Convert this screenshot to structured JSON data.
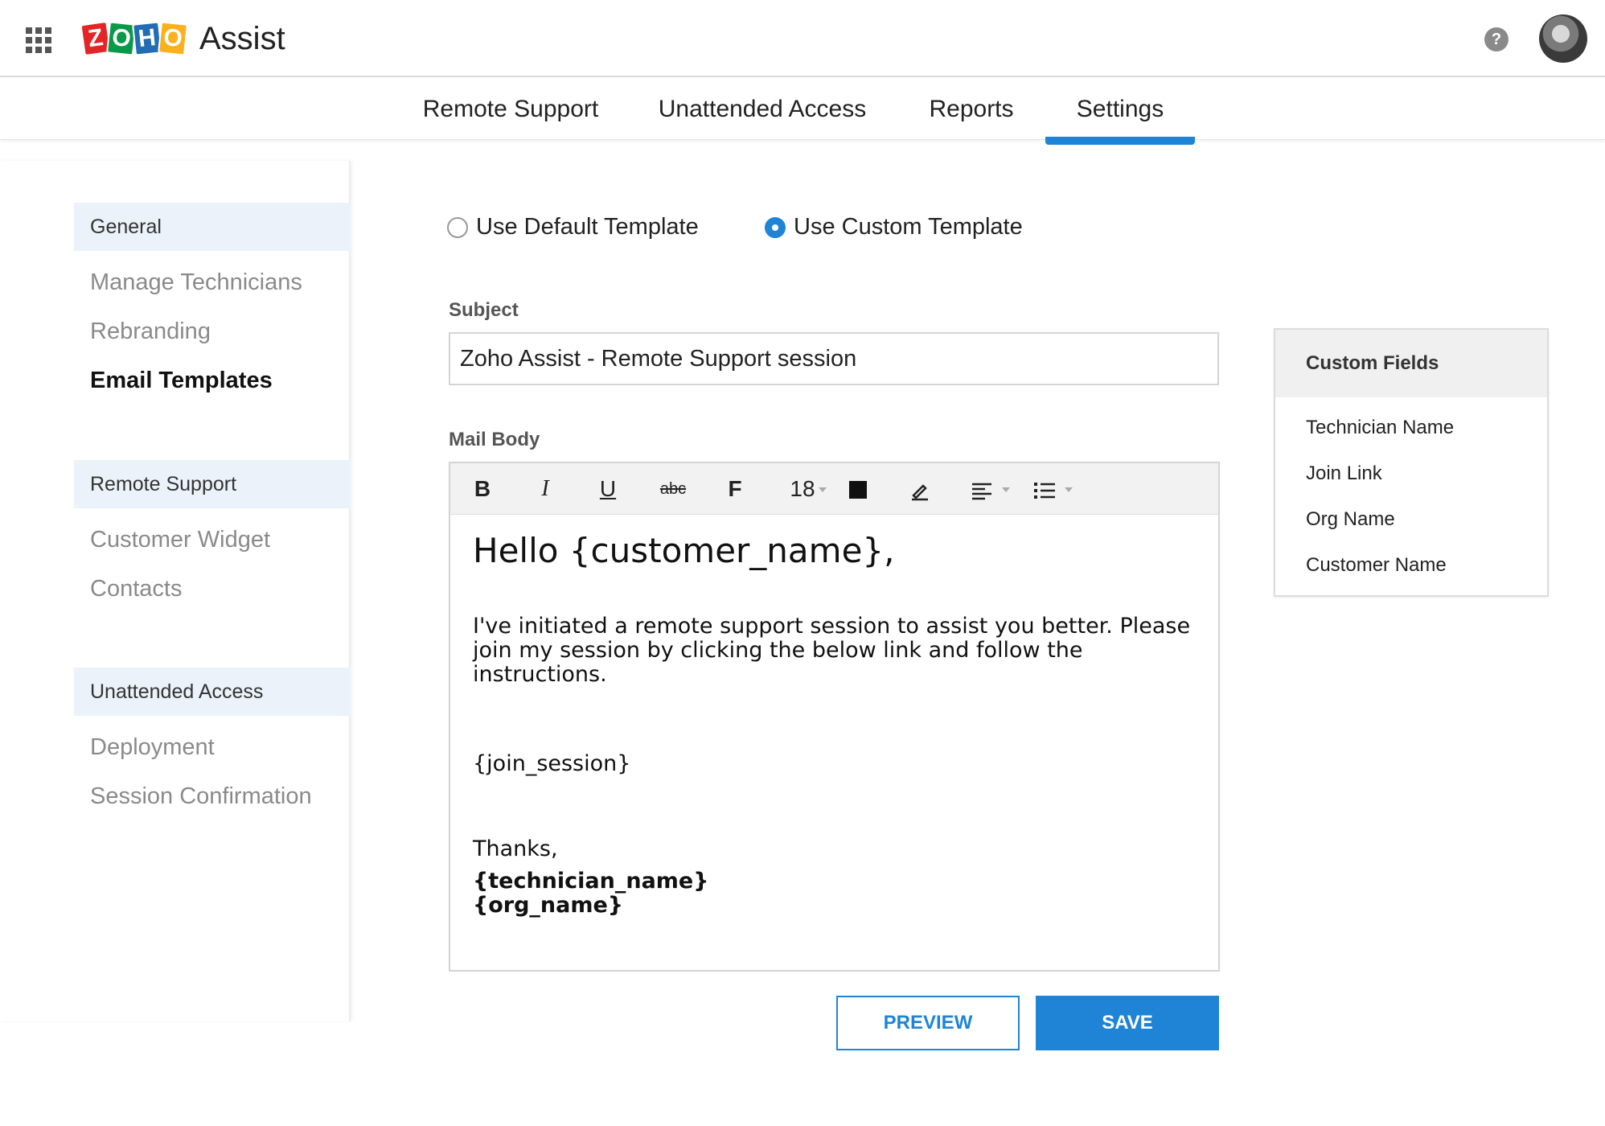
{
  "header": {
    "logo_letters": [
      "Z",
      "O",
      "H",
      "O"
    ],
    "app_name": "Assist",
    "help_symbol": "?"
  },
  "nav": {
    "tabs": [
      "Remote Support",
      "Unattended Access",
      "Reports",
      "Settings"
    ],
    "active": "Settings"
  },
  "sidebar": {
    "sections": [
      {
        "title": "General",
        "items": [
          "Manage Technicians",
          "Rebranding",
          "Email Templates"
        ]
      },
      {
        "title": "Remote Support",
        "items": [
          "Customer Widget",
          "Contacts"
        ]
      },
      {
        "title": "Unattended Access",
        "items": [
          "Deployment",
          "Session Confirmation"
        ]
      }
    ],
    "active_item": "Email Templates"
  },
  "template_choice": {
    "default_label": "Use Default Template",
    "custom_label": "Use Custom Template",
    "selected": "custom"
  },
  "subject": {
    "label": "Subject",
    "value": "Zoho Assist - Remote Support session"
  },
  "mail_body": {
    "label": "Mail Body",
    "toolbar": {
      "bold": "B",
      "italic": "I",
      "underline": "U",
      "strike": "abc",
      "font": "F",
      "font_size": "18",
      "align_glyph": "≡",
      "list_glyph": "☰"
    },
    "greeting": "Hello {customer_name},",
    "paragraph": "I've initiated a remote support session to assist you better. Please join my session by clicking the below link and follow the instructions.",
    "join": "{join_session}",
    "thanks": "Thanks,",
    "technician": "{technician_name}",
    "org": "{org_name}"
  },
  "buttons": {
    "preview": "PREVIEW",
    "save": "SAVE"
  },
  "custom_fields": {
    "title": "Custom Fields",
    "items": [
      "Technician Name",
      "Join Link",
      "Org Name",
      "Customer Name"
    ]
  },
  "colors": {
    "accent": "#1f84d6",
    "sidebar_section_bg": "#ebf2fa"
  }
}
